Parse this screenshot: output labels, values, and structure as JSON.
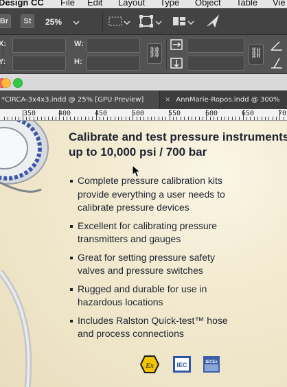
{
  "menubar": {
    "items": [
      "Design CC",
      "File",
      "Edit",
      "Layout",
      "Type",
      "Object",
      "Table",
      "Vie"
    ]
  },
  "appbar": {
    "bridge": "Br",
    "stock": "St",
    "zoom": "25%"
  },
  "control_panel": {
    "x_label": "X:",
    "y_label": "Y:",
    "w_label": "W:",
    "h_label": "H:"
  },
  "tabs": [
    {
      "label": "*CIRCA-3x4x3.indd @ 25% [GPU Preview]"
    },
    {
      "close": "×",
      "label": "AnnMarie-Ropos.indd @ 300%"
    }
  ],
  "ruler": {
    "ticks": [
      "350",
      "400",
      "450",
      "500",
      "550",
      "600",
      "650",
      "70"
    ]
  },
  "document": {
    "title_line1": "Calibrate and test pressure instruments",
    "title_line2": "up to 10,000 psi / 700 bar",
    "bullets": [
      [
        "Complete pressure calibration kits",
        "provide everything a user needs to",
        "calibrate pressure devices"
      ],
      [
        "Excellent for calibrating pressure",
        "transmitters and gauges"
      ],
      [
        "Great for setting pressure safety",
        "valves and pressure switches"
      ],
      [
        "Rugged and durable for use in",
        "hazardous locations"
      ],
      [
        "Includes Ralston Quick-test™ hose",
        "and process connections"
      ]
    ],
    "logos": {
      "ex": "Ex",
      "iec": "IEC",
      "ecex": "IECEx"
    }
  }
}
